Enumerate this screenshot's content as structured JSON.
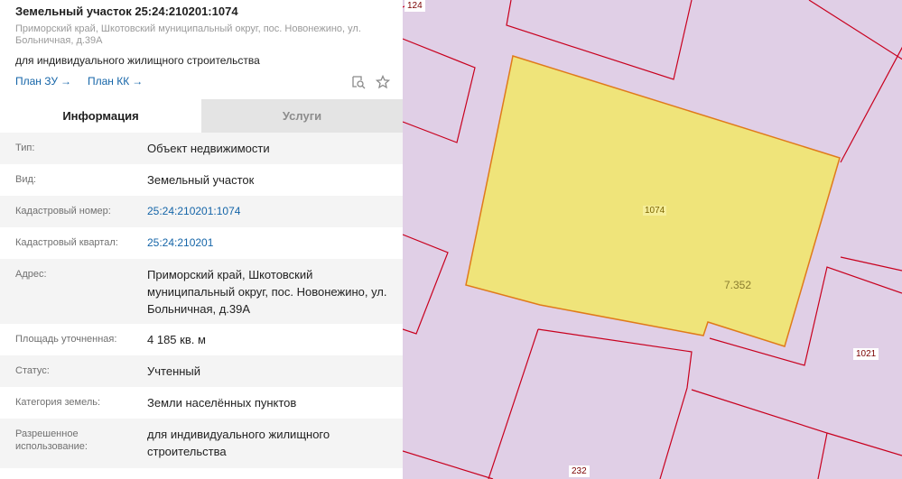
{
  "header": {
    "title": "Земельный участок 25:24:210201:1074",
    "address": "Приморский край, Шкотовский муниципальный округ, пос. Новонежино, ул. Больничная, д.39А",
    "usage": "для индивидуального жилищного строительства",
    "links": [
      {
        "label": "План ЗУ",
        "arrow": "→"
      },
      {
        "label": "План КК",
        "arrow": "→"
      }
    ],
    "tools": [
      "search-map-icon",
      "star-icon"
    ]
  },
  "tabs": [
    {
      "label": "Информация",
      "active": true
    },
    {
      "label": "Услуги",
      "active": false
    }
  ],
  "properties": [
    {
      "label": "Тип:",
      "value": "Объект недвижимости"
    },
    {
      "label": "Вид:",
      "value": "Земельный участок"
    },
    {
      "label": "Кадастровый номер:",
      "value": "25:24:210201:1074",
      "is_link": true
    },
    {
      "label": "Кадастровый квартал:",
      "value": "25:24:210201",
      "is_link": true
    },
    {
      "label": "Адрес:",
      "value": "Приморский край, Шкотовский муниципальный округ, пос. Новонежино, ул. Больничная, д.39А"
    },
    {
      "label": "Площадь уточненная:",
      "value": "4 185 кв. м"
    },
    {
      "label": "Статус:",
      "value": "Учтенный"
    },
    {
      "label": "Категория земель:",
      "value": "Земли населённых пунктов"
    },
    {
      "label": "Разрешенное использование:",
      "value": "для индивидуального жилищного строительства"
    }
  ],
  "map": {
    "labels": {
      "parcel_1074": "1074",
      "parcel_124": "124",
      "parcel_1021": "1021",
      "parcel_232": "232",
      "value_7352": "7.352"
    },
    "colors": {
      "background": "#e0cfe6",
      "selected_fill": "#efe47a",
      "boundary": "#c8001e",
      "selected_stroke": "#e07a1a"
    }
  }
}
